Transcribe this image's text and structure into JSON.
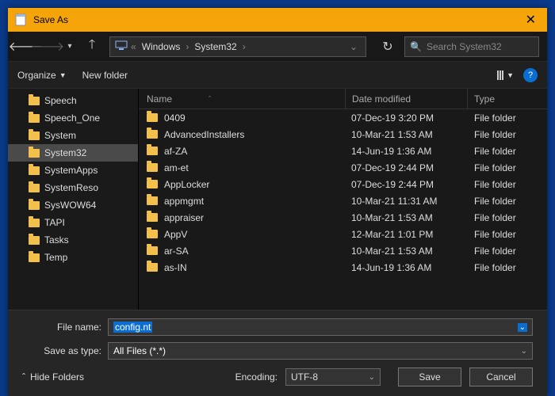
{
  "title": "Save As",
  "breadcrumbs": {
    "sep": "«",
    "items": [
      "Windows",
      "System32"
    ]
  },
  "search": {
    "placeholder": "Search System32"
  },
  "toolbar": {
    "organize": "Organize",
    "newfolder": "New folder"
  },
  "columns": {
    "name": "Name",
    "date": "Date modified",
    "type": "Type"
  },
  "tree": [
    {
      "label": "Speech"
    },
    {
      "label": "Speech_One"
    },
    {
      "label": "System"
    },
    {
      "label": "System32",
      "selected": true
    },
    {
      "label": "SystemApps"
    },
    {
      "label": "SystemReso"
    },
    {
      "label": "SysWOW64"
    },
    {
      "label": "TAPI"
    },
    {
      "label": "Tasks"
    },
    {
      "label": "Temp"
    }
  ],
  "rows": [
    {
      "name": "0409",
      "date": "07-Dec-19 3:20 PM",
      "type": "File folder"
    },
    {
      "name": "AdvancedInstallers",
      "date": "10-Mar-21 1:53 AM",
      "type": "File folder"
    },
    {
      "name": "af-ZA",
      "date": "14-Jun-19 1:36 AM",
      "type": "File folder"
    },
    {
      "name": "am-et",
      "date": "07-Dec-19 2:44 PM",
      "type": "File folder"
    },
    {
      "name": "AppLocker",
      "date": "07-Dec-19 2:44 PM",
      "type": "File folder"
    },
    {
      "name": "appmgmt",
      "date": "10-Mar-21 11:31 AM",
      "type": "File folder"
    },
    {
      "name": "appraiser",
      "date": "10-Mar-21 1:53 AM",
      "type": "File folder"
    },
    {
      "name": "AppV",
      "date": "12-Mar-21 1:01 PM",
      "type": "File folder"
    },
    {
      "name": "ar-SA",
      "date": "10-Mar-21 1:53 AM",
      "type": "File folder"
    },
    {
      "name": "as-IN",
      "date": "14-Jun-19 1:36 AM",
      "type": "File folder"
    }
  ],
  "form": {
    "filename_label": "File name:",
    "filename_value": "config.nt",
    "saveas_label": "Save as type:",
    "saveas_value": "All Files  (*.*)",
    "encoding_label": "Encoding:",
    "encoding_value": "UTF-8",
    "hide_folders": "Hide Folders",
    "save": "Save",
    "cancel": "Cancel"
  }
}
